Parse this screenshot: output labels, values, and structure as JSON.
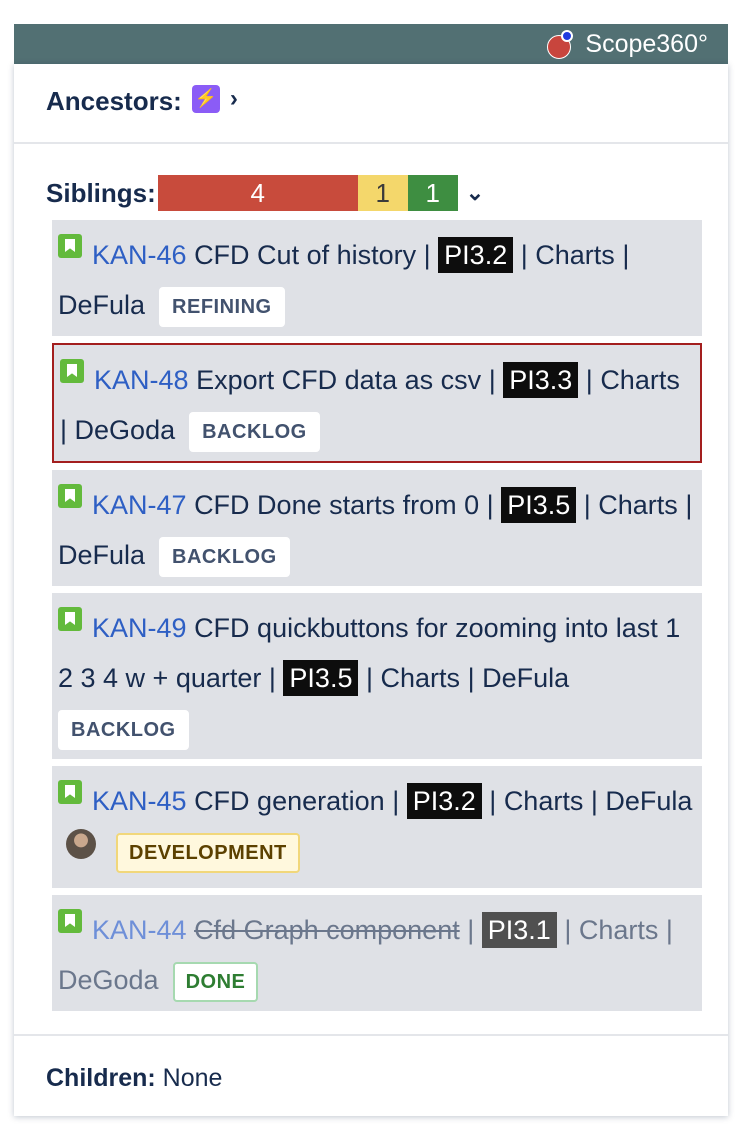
{
  "brand": {
    "name": "Scope360°"
  },
  "ancestors": {
    "label": "Ancestors:"
  },
  "siblings": {
    "label": "Siblings:",
    "counts": {
      "todo": "4",
      "in_progress": "1",
      "done": "1"
    },
    "colors": {
      "todo": "#c84b3c",
      "in_progress": "#f4d76b",
      "done": "#3e8e41"
    }
  },
  "issues": [
    {
      "key": "KAN-46",
      "title": "CFD Cut of history",
      "pi": "PI3.2",
      "component": "Charts",
      "assignee": "DeFula",
      "status": "REFINING"
    },
    {
      "key": "KAN-48",
      "title": "Export CFD data as csv",
      "pi": "PI3.3",
      "component": "Charts",
      "assignee": "DeGoda",
      "status": "BACKLOG"
    },
    {
      "key": "KAN-47",
      "title": "CFD Done starts from 0",
      "pi": "PI3.5",
      "component": "Charts",
      "assignee": "DeFula",
      "status": "BACKLOG"
    },
    {
      "key": "KAN-49",
      "title": "CFD quickbuttons for zooming into last 1 2 3 4 w + quarter",
      "pi": "PI3.5",
      "component": "Charts",
      "assignee": "DeFula",
      "status": "BACKLOG"
    },
    {
      "key": "KAN-45",
      "title": "CFD generation",
      "pi": "PI3.2",
      "component": "Charts",
      "assignee": "DeFula",
      "status": "DEVELOPMENT"
    },
    {
      "key": "KAN-44",
      "title": "Cfd Graph component",
      "pi": "PI3.1",
      "component": "Charts",
      "assignee": "DeGoda",
      "status": "DONE"
    }
  ],
  "separator": "|",
  "children": {
    "label": "Children:",
    "value": "None"
  }
}
